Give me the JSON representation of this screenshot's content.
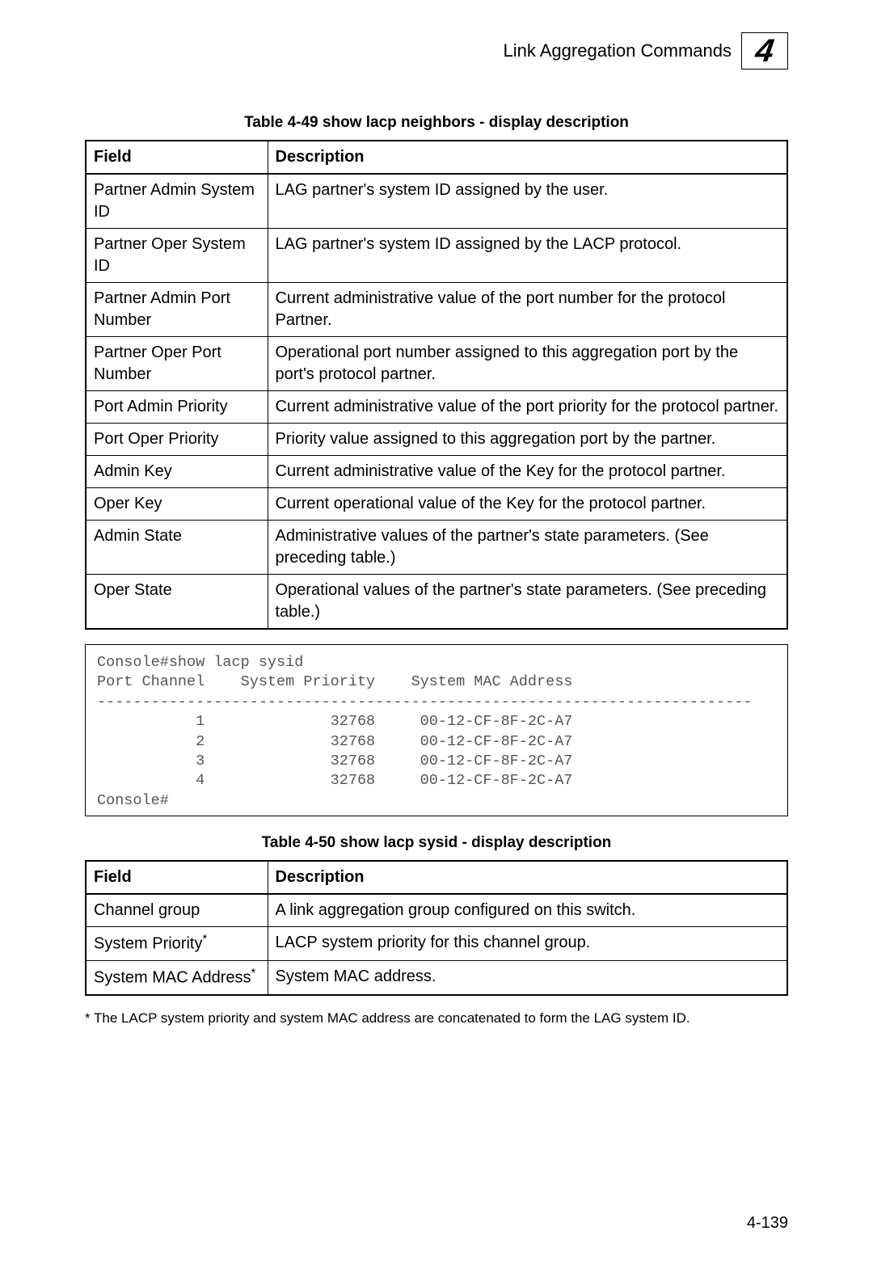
{
  "header": {
    "title": "Link Aggregation Commands",
    "chapter_number": "4"
  },
  "table49": {
    "caption": "Table 4-49    show lacp neighbors - display description",
    "headers": {
      "field": "Field",
      "description": "Description"
    },
    "rows": [
      {
        "field": "Partner Admin System ID",
        "description": "LAG partner's system ID assigned by the user."
      },
      {
        "field": "Partner Oper System ID",
        "description": "LAG partner's system ID assigned by the LACP protocol."
      },
      {
        "field": "Partner Admin Port Number",
        "description": "Current administrative value of the port number for the protocol Partner."
      },
      {
        "field": "Partner Oper Port Number",
        "description": "Operational port number assigned to this aggregation port by the port's protocol partner."
      },
      {
        "field": "Port Admin Priority",
        "description": "Current administrative value of the port priority for the protocol partner."
      },
      {
        "field": "Port Oper Priority",
        "description": "Priority value assigned to this aggregation port by the partner."
      },
      {
        "field": "Admin Key",
        "description": "Current administrative value of the Key for the protocol partner."
      },
      {
        "field": "Oper Key",
        "description": "Current operational value of the Key for the protocol partner."
      },
      {
        "field": "Admin State",
        "description": "Administrative values of the partner's state parameters. (See preceding table.)"
      },
      {
        "field": "Oper State",
        "description": "Operational values of the partner's state parameters. (See preceding table.)"
      }
    ]
  },
  "console": {
    "text": "Console#show lacp sysid\nPort Channel    System Priority    System MAC Address\n-------------------------------------------------------------------------\n           1              32768     00-12-CF-8F-2C-A7\n           2              32768     00-12-CF-8F-2C-A7\n           3              32768     00-12-CF-8F-2C-A7\n           4              32768     00-12-CF-8F-2C-A7\nConsole#"
  },
  "table50": {
    "caption": "Table 4-50    show lacp sysid - display description",
    "headers": {
      "field": "Field",
      "description": "Description"
    },
    "rows": [
      {
        "field": "Channel group",
        "footnote": "",
        "description": "A link aggregation group configured on this switch."
      },
      {
        "field": "System Priority",
        "footnote": "*",
        "description": "LACP system priority for this channel group."
      },
      {
        "field": "System MAC Address",
        "footnote": "*",
        "description": "System MAC address."
      }
    ]
  },
  "footnote": "*  The LACP system priority and system MAC address are concatenated to form the LAG system ID.",
  "page_number": "4-139"
}
